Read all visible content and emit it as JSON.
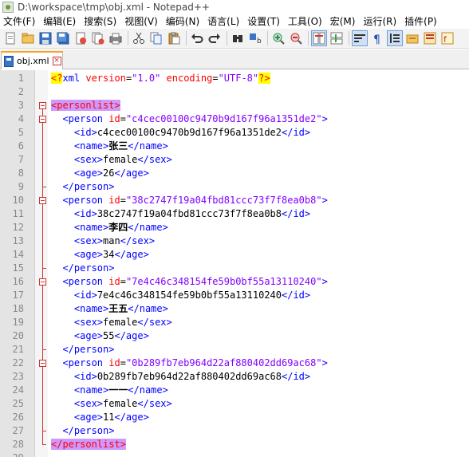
{
  "window": {
    "title": "D:\\workspace\\tmp\\obj.xml - Notepad++"
  },
  "menu": [
    "文件(F)",
    "编辑(E)",
    "搜索(S)",
    "视图(V)",
    "编码(N)",
    "语言(L)",
    "设置(T)",
    "工具(O)",
    "宏(M)",
    "运行(R)",
    "插件(P)"
  ],
  "toolbar": {
    "buttons": [
      {
        "icon": "new-file-icon"
      },
      {
        "icon": "open-file-icon"
      },
      {
        "icon": "save-icon"
      },
      {
        "icon": "save-all-icon"
      },
      {
        "icon": "close-icon"
      },
      {
        "icon": "close-all-icon"
      },
      {
        "icon": "print-icon"
      },
      {
        "icon": "cut-icon"
      },
      {
        "icon": "copy-icon"
      },
      {
        "icon": "paste-icon"
      },
      {
        "icon": "undo-icon"
      },
      {
        "icon": "redo-icon"
      },
      {
        "icon": "find-icon"
      },
      {
        "icon": "replace-icon"
      },
      {
        "icon": "zoom-in-icon"
      },
      {
        "icon": "zoom-out-icon"
      },
      {
        "icon": "sync-vertical-icon"
      },
      {
        "icon": "sync-horizontal-icon"
      },
      {
        "icon": "word-wrap-icon"
      },
      {
        "icon": "show-all-chars-icon"
      },
      {
        "icon": "indent-guide-icon"
      },
      {
        "icon": "folder-as-workspace-icon"
      },
      {
        "icon": "doc-map-icon"
      },
      {
        "icon": "function-list-icon"
      }
    ]
  },
  "tab": {
    "label": "obj.xml"
  },
  "editor": {
    "lines": [
      {
        "n": "1",
        "segs": [
          {
            "c": "pi",
            "t": "<?"
          },
          {
            "c": "tag",
            "t": "xml "
          },
          {
            "c": "attr",
            "t": "version"
          },
          {
            "c": "text",
            "t": "="
          },
          {
            "c": "val",
            "t": "\"1.0\""
          },
          {
            "c": "text",
            "t": " "
          },
          {
            "c": "attr",
            "t": "encoding"
          },
          {
            "c": "text",
            "t": "="
          },
          {
            "c": "val",
            "t": "\"UTF-8\""
          },
          {
            "c": "pi",
            "t": "?>"
          }
        ]
      },
      {
        "n": "2",
        "segs": []
      },
      {
        "n": "3",
        "fold": "open",
        "segs": [
          {
            "c": "ptag",
            "t": "<personlist>"
          }
        ]
      },
      {
        "n": "4",
        "fold": "open2",
        "segs": [
          {
            "c": "text",
            "t": "  "
          },
          {
            "c": "tag",
            "t": "<person "
          },
          {
            "c": "attr",
            "t": "id"
          },
          {
            "c": "text",
            "t": "="
          },
          {
            "c": "val",
            "t": "\"c4cec00100c9470b9d167f96a1351de2\""
          },
          {
            "c": "tag",
            "t": ">"
          }
        ]
      },
      {
        "n": "5",
        "fold": "line",
        "segs": [
          {
            "c": "text",
            "t": "    "
          },
          {
            "c": "tag",
            "t": "<id>"
          },
          {
            "c": "text",
            "t": "c4cec00100c9470b9d167f96a1351de2"
          },
          {
            "c": "tag",
            "t": "</id>"
          }
        ]
      },
      {
        "n": "6",
        "fold": "line",
        "segs": [
          {
            "c": "text",
            "t": "    "
          },
          {
            "c": "tag",
            "t": "<name>"
          },
          {
            "c": "cjk",
            "t": "张三"
          },
          {
            "c": "tag",
            "t": "</name>"
          }
        ]
      },
      {
        "n": "7",
        "fold": "line",
        "segs": [
          {
            "c": "text",
            "t": "    "
          },
          {
            "c": "tag",
            "t": "<sex>"
          },
          {
            "c": "text",
            "t": "female"
          },
          {
            "c": "tag",
            "t": "</sex>"
          }
        ]
      },
      {
        "n": "8",
        "fold": "line",
        "segs": [
          {
            "c": "text",
            "t": "    "
          },
          {
            "c": "tag",
            "t": "<age>"
          },
          {
            "c": "text",
            "t": "26"
          },
          {
            "c": "tag",
            "t": "</age>"
          }
        ]
      },
      {
        "n": "9",
        "fold": "end",
        "segs": [
          {
            "c": "text",
            "t": "  "
          },
          {
            "c": "tag",
            "t": "</person>"
          }
        ]
      },
      {
        "n": "10",
        "fold": "open2",
        "segs": [
          {
            "c": "text",
            "t": "  "
          },
          {
            "c": "tag",
            "t": "<person "
          },
          {
            "c": "attr",
            "t": "id"
          },
          {
            "c": "text",
            "t": "="
          },
          {
            "c": "val",
            "t": "\"38c2747f19a04fbd81ccc73f7f8ea0b8\""
          },
          {
            "c": "tag",
            "t": ">"
          }
        ]
      },
      {
        "n": "11",
        "fold": "line",
        "segs": [
          {
            "c": "text",
            "t": "    "
          },
          {
            "c": "tag",
            "t": "<id>"
          },
          {
            "c": "text",
            "t": "38c2747f19a04fbd81ccc73f7f8ea0b8"
          },
          {
            "c": "tag",
            "t": "</id>"
          }
        ]
      },
      {
        "n": "12",
        "fold": "line",
        "segs": [
          {
            "c": "text",
            "t": "    "
          },
          {
            "c": "tag",
            "t": "<name>"
          },
          {
            "c": "cjk",
            "t": "李四"
          },
          {
            "c": "tag",
            "t": "</name>"
          }
        ]
      },
      {
        "n": "13",
        "fold": "line",
        "segs": [
          {
            "c": "text",
            "t": "    "
          },
          {
            "c": "tag",
            "t": "<sex>"
          },
          {
            "c": "text",
            "t": "man"
          },
          {
            "c": "tag",
            "t": "</sex>"
          }
        ]
      },
      {
        "n": "14",
        "fold": "line",
        "segs": [
          {
            "c": "text",
            "t": "    "
          },
          {
            "c": "tag",
            "t": "<age>"
          },
          {
            "c": "text",
            "t": "34"
          },
          {
            "c": "tag",
            "t": "</age>"
          }
        ]
      },
      {
        "n": "15",
        "fold": "end",
        "segs": [
          {
            "c": "text",
            "t": "  "
          },
          {
            "c": "tag",
            "t": "</person>"
          }
        ]
      },
      {
        "n": "16",
        "fold": "open2",
        "segs": [
          {
            "c": "text",
            "t": "  "
          },
          {
            "c": "tag",
            "t": "<person "
          },
          {
            "c": "attr",
            "t": "id"
          },
          {
            "c": "text",
            "t": "="
          },
          {
            "c": "val",
            "t": "\"7e4c46c348154fe59b0bf55a13110240\""
          },
          {
            "c": "tag",
            "t": ">"
          }
        ]
      },
      {
        "n": "17",
        "fold": "line",
        "segs": [
          {
            "c": "text",
            "t": "    "
          },
          {
            "c": "tag",
            "t": "<id>"
          },
          {
            "c": "text",
            "t": "7e4c46c348154fe59b0bf55a13110240"
          },
          {
            "c": "tag",
            "t": "</id>"
          }
        ]
      },
      {
        "n": "18",
        "fold": "line",
        "segs": [
          {
            "c": "text",
            "t": "    "
          },
          {
            "c": "tag",
            "t": "<name>"
          },
          {
            "c": "cjk",
            "t": "王五"
          },
          {
            "c": "tag",
            "t": "</name>"
          }
        ]
      },
      {
        "n": "19",
        "fold": "line",
        "segs": [
          {
            "c": "text",
            "t": "    "
          },
          {
            "c": "tag",
            "t": "<sex>"
          },
          {
            "c": "text",
            "t": "female"
          },
          {
            "c": "tag",
            "t": "</sex>"
          }
        ]
      },
      {
        "n": "20",
        "fold": "line",
        "segs": [
          {
            "c": "text",
            "t": "    "
          },
          {
            "c": "tag",
            "t": "<age>"
          },
          {
            "c": "text",
            "t": "55"
          },
          {
            "c": "tag",
            "t": "</age>"
          }
        ]
      },
      {
        "n": "21",
        "fold": "end",
        "segs": [
          {
            "c": "text",
            "t": "  "
          },
          {
            "c": "tag",
            "t": "</person>"
          }
        ]
      },
      {
        "n": "22",
        "fold": "open2",
        "segs": [
          {
            "c": "text",
            "t": "  "
          },
          {
            "c": "tag",
            "t": "<person "
          },
          {
            "c": "attr",
            "t": "id"
          },
          {
            "c": "text",
            "t": "="
          },
          {
            "c": "val",
            "t": "\"0b289fb7eb964d22af880402dd69ac68\""
          },
          {
            "c": "tag",
            "t": ">"
          }
        ]
      },
      {
        "n": "23",
        "fold": "line",
        "segs": [
          {
            "c": "text",
            "t": "    "
          },
          {
            "c": "tag",
            "t": "<id>"
          },
          {
            "c": "text",
            "t": "0b289fb7eb964d22af880402dd69ac68"
          },
          {
            "c": "tag",
            "t": "</id>"
          }
        ]
      },
      {
        "n": "24",
        "fold": "line",
        "segs": [
          {
            "c": "text",
            "t": "    "
          },
          {
            "c": "tag",
            "t": "<name>"
          },
          {
            "c": "cjk",
            "t": "一一"
          },
          {
            "c": "tag",
            "t": "</name>"
          }
        ]
      },
      {
        "n": "25",
        "fold": "line",
        "segs": [
          {
            "c": "text",
            "t": "    "
          },
          {
            "c": "tag",
            "t": "<sex>"
          },
          {
            "c": "text",
            "t": "female"
          },
          {
            "c": "tag",
            "t": "</sex>"
          }
        ]
      },
      {
        "n": "26",
        "fold": "line",
        "segs": [
          {
            "c": "text",
            "t": "    "
          },
          {
            "c": "tag",
            "t": "<age>"
          },
          {
            "c": "text",
            "t": "11"
          },
          {
            "c": "tag",
            "t": "</age>"
          }
        ]
      },
      {
        "n": "27",
        "fold": "end",
        "segs": [
          {
            "c": "text",
            "t": "  "
          },
          {
            "c": "tag",
            "t": "</person>"
          }
        ]
      },
      {
        "n": "28",
        "fold": "end1",
        "segs": [
          {
            "c": "ptag",
            "t": "</personlist>"
          }
        ]
      },
      {
        "n": "29",
        "segs": []
      }
    ]
  },
  "colors": {
    "tag": "#0000ff",
    "attr": "#ff0000",
    "value": "#8000ff",
    "tab_accent": "#f9a628",
    "fold_marker": "#cc3333"
  }
}
